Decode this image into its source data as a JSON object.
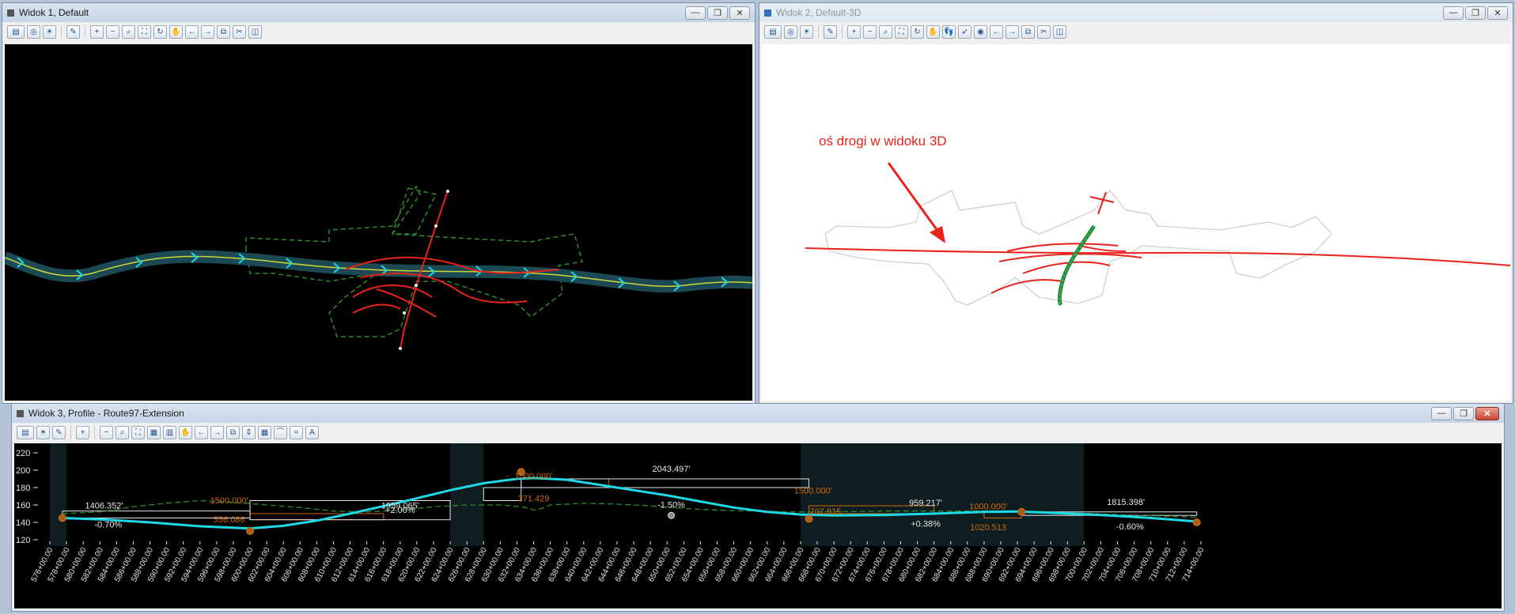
{
  "colors": {
    "alignment_cyan": "#1ed9e6",
    "proposed_red": "#e8231c",
    "existing_green": "#2e8b2e",
    "grade_orange": "#d2690f",
    "dim_white": "#e6e6e6"
  },
  "views": [
    {
      "title": "Widok 1, Default"
    },
    {
      "title": "Widok 2, Default-3D"
    },
    {
      "title": "Widok 3, Profile - Route97-Extension"
    }
  ],
  "window_buttons": {
    "minimize": "—",
    "restore": "❐",
    "close": "✕"
  },
  "toolbar_icons_1": [
    "view-attributes-icon",
    "display-style-icon",
    "brightness-icon",
    "update-view-icon",
    "zoom-in-icon",
    "zoom-out-icon",
    "window-area-icon",
    "fit-view-icon",
    "rotate-view-icon",
    "pan-icon",
    "previous-view-icon",
    "next-view-icon",
    "copy-view-icon",
    "clip-volume-icon",
    "clip-mask-icon"
  ],
  "toolbar_icons_2": [
    "view-attributes-icon",
    "display-style-icon",
    "brightness-icon",
    "update-view-icon",
    "zoom-in-icon",
    "zoom-out-icon",
    "window-area-icon",
    "fit-view-icon",
    "rotate-view-icon",
    "pan-icon",
    "walk-icon",
    "fly-icon",
    "camera-icon",
    "previous-view-icon",
    "next-view-icon",
    "copy-view-icon",
    "clip-volume-icon",
    "clip-mask-icon"
  ],
  "toolbar_icons_3": [
    "view-attributes-icon",
    "brightness-icon",
    "update-view-icon",
    "zoom-in-icon",
    "zoom-out-icon",
    "window-area-icon",
    "fit-view-icon",
    "grid-icon",
    "calculator-icon",
    "pan-icon",
    "previous-view-icon",
    "next-view-icon",
    "copy-view-icon",
    "exaggeration-icon",
    "table-icon",
    "profile-icon",
    "profile-compare-icon",
    "text-icon"
  ],
  "annotation_3d": {
    "text": "oś drogi w widoku 3D"
  },
  "profile": {
    "y_axis": {
      "min": 120,
      "max": 220,
      "ticks": [
        "220",
        "200",
        "180",
        "160",
        "140",
        "120"
      ]
    },
    "stations": [
      "576+00.00",
      "578+00.00",
      "580+00.00",
      "582+00.00",
      "584+00.00",
      "586+00.00",
      "588+00.00",
      "590+00.00",
      "592+00.00",
      "594+00.00",
      "596+00.00",
      "598+00.00",
      "600+00.00",
      "602+00.00",
      "604+00.00",
      "606+00.00",
      "608+00.00",
      "610+00.00",
      "612+00.00",
      "614+00.00",
      "616+00.00",
      "618+00.00",
      "620+00.00",
      "622+00.00",
      "624+00.00",
      "626+00.00",
      "628+00.00",
      "630+00.00",
      "632+00.00",
      "634+00.00",
      "636+00.00",
      "638+00.00",
      "640+00.00",
      "642+00.00",
      "644+00.00",
      "646+00.00",
      "648+00.00",
      "650+00.00",
      "652+00.00",
      "654+00.00",
      "656+00.00",
      "658+00.00",
      "660+00.00",
      "662+00.00",
      "664+00.00",
      "666+00.00",
      "668+00.00",
      "670+00.00",
      "672+00.00",
      "674+00.00",
      "676+00.00",
      "678+00.00",
      "680+00.00",
      "682+00.00",
      "684+00.00",
      "686+00.00",
      "688+00.00",
      "690+00.00",
      "692+00.00",
      "694+00.00",
      "696+00.00",
      "698+00.00",
      "700+00.00",
      "702+00.00",
      "704+00.00",
      "706+00.00",
      "708+00.00",
      "710+00.00",
      "712+00.00",
      "714+00.00"
    ],
    "labels": [
      {
        "text": "1406.352'",
        "station": 582.5,
        "elev": 156,
        "color": "white"
      },
      {
        "text": "-0.70%",
        "station": 583.0,
        "elev": 134,
        "color": "white"
      },
      {
        "text": "1500.000'",
        "station": 597.5,
        "elev": 162,
        "color": "orange"
      },
      {
        "text": "556.086",
        "station": 597.5,
        "elev": 140,
        "color": "orange"
      },
      {
        "text": "1959.065'",
        "station": 618.0,
        "elev": 156,
        "color": "white"
      },
      {
        "text": "+2.00%",
        "station": 618.0,
        "elev": 151,
        "color": "white"
      },
      {
        "text": "1500.000'",
        "station": 634.0,
        "elev": 190,
        "color": "orange"
      },
      {
        "text": "371.429",
        "station": 634.0,
        "elev": 164,
        "color": "orange"
      },
      {
        "text": "2043.497'",
        "station": 650.5,
        "elev": 198,
        "color": "white"
      },
      {
        "text": "-1.50%",
        "station": 650.5,
        "elev": 157,
        "color": "white"
      },
      {
        "text": "1500.000'",
        "station": 667.5,
        "elev": 173,
        "color": "orange"
      },
      {
        "text": "707.915",
        "station": 669.0,
        "elev": 149,
        "color": "orange"
      },
      {
        "text": "959.217'",
        "station": 681.0,
        "elev": 159,
        "color": "white"
      },
      {
        "text": "+0.38%",
        "station": 681.0,
        "elev": 135,
        "color": "white"
      },
      {
        "text": "1000.000'",
        "station": 688.5,
        "elev": 155,
        "color": "orange"
      },
      {
        "text": "1020.513",
        "station": 688.5,
        "elev": 131,
        "color": "orange"
      },
      {
        "text": "1815.398'",
        "station": 705.0,
        "elev": 160,
        "color": "white"
      },
      {
        "text": "-0.60%",
        "station": 705.5,
        "elev": 132,
        "color": "white"
      }
    ],
    "pvis": [
      {
        "station": 577.5,
        "elev": 145
      },
      {
        "station": 600.0,
        "elev": 130
      },
      {
        "station": 632.5,
        "elev": 198
      },
      {
        "station": 667.0,
        "elev": 144
      },
      {
        "station": 692.5,
        "elev": 152
      },
      {
        "station": 713.5,
        "elev": 140
      }
    ],
    "design_profile": [
      [
        577.5,
        145
      ],
      [
        582,
        143.5
      ],
      [
        588,
        140
      ],
      [
        594,
        135.5
      ],
      [
        600,
        133
      ],
      [
        604,
        136
      ],
      [
        608,
        142
      ],
      [
        612,
        150
      ],
      [
        618,
        163
      ],
      [
        624,
        177
      ],
      [
        628,
        185
      ],
      [
        632,
        190
      ],
      [
        634,
        191
      ],
      [
        638,
        189
      ],
      [
        642,
        183
      ],
      [
        646,
        177
      ],
      [
        650,
        171
      ],
      [
        654,
        164
      ],
      [
        658,
        157
      ],
      [
        662,
        152
      ],
      [
        666,
        149
      ],
      [
        670,
        148
      ],
      [
        676,
        148.5
      ],
      [
        682,
        150
      ],
      [
        688,
        152
      ],
      [
        692,
        152.5
      ],
      [
        696,
        151
      ],
      [
        702,
        148.5
      ],
      [
        708,
        145
      ],
      [
        713.5,
        141
      ]
    ],
    "existing_ground": [
      [
        577.5,
        150
      ],
      [
        582,
        152
      ],
      [
        586,
        158
      ],
      [
        590,
        162
      ],
      [
        594,
        165
      ],
      [
        598,
        163
      ],
      [
        602,
        160
      ],
      [
        606,
        157
      ],
      [
        610,
        153
      ],
      [
        614,
        152
      ],
      [
        618,
        154
      ],
      [
        622,
        158
      ],
      [
        626,
        160
      ],
      [
        630,
        160
      ],
      [
        632.5,
        158
      ],
      [
        633.5,
        156
      ],
      [
        634,
        154
      ],
      [
        635,
        156
      ],
      [
        636,
        160
      ],
      [
        640,
        162
      ],
      [
        644,
        161
      ],
      [
        648,
        159
      ],
      [
        652,
        156
      ],
      [
        656,
        154
      ],
      [
        660,
        153
      ],
      [
        664,
        152
      ],
      [
        668,
        152
      ],
      [
        672,
        152.5
      ],
      [
        676,
        153
      ],
      [
        682,
        153
      ],
      [
        688,
        153
      ],
      [
        692,
        152.5
      ],
      [
        698,
        151
      ],
      [
        704,
        149
      ],
      [
        710,
        147
      ],
      [
        713.5,
        146
      ]
    ]
  }
}
